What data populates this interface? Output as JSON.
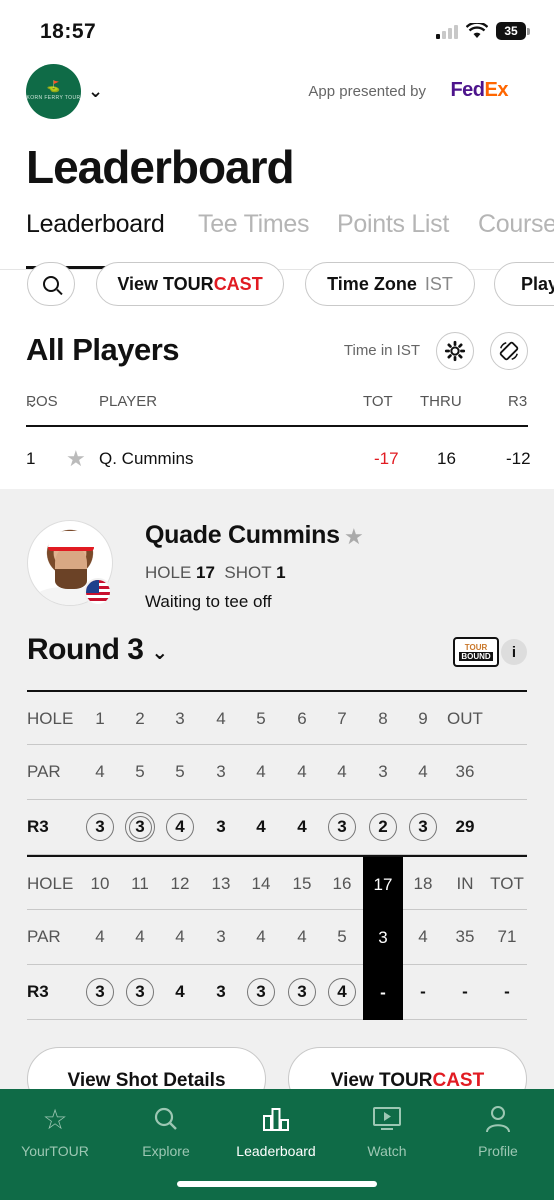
{
  "status": {
    "time": "18:57",
    "battery": "35"
  },
  "brand": {
    "presented_by": "App presented by",
    "sponsor_a": "Fed",
    "sponsor_b": "Ex",
    "logo_text": "KORN FERRY TOUR"
  },
  "page_title": "Leaderboard",
  "tabs": [
    "Leaderboard",
    "Tee Times",
    "Points List",
    "Course"
  ],
  "chips": {
    "tourcast_a": "View TOUR",
    "tourcast_b": "CAST",
    "timezone_label": "Time Zone",
    "timezone_value": "IST",
    "partial": "Play"
  },
  "section": {
    "title": "All Players",
    "time_in": "Time in IST"
  },
  "table_head": {
    "pos": "POS",
    "player": "PLAYER",
    "tot": "TOT",
    "thru": "THRU",
    "r3": "R3"
  },
  "row": {
    "pos": "1",
    "player": "Q. Cummins",
    "tot": "-17",
    "thru": "16",
    "r3": "-12"
  },
  "player": {
    "name": "Quade Cummins",
    "hole_label": "HOLE",
    "hole": "17",
    "shot_label": "SHOT",
    "shot": "1",
    "status": "Waiting to tee off"
  },
  "round": {
    "title": "Round 3",
    "badge_a": "TOUR",
    "badge_b": "BOUND",
    "info": "i"
  },
  "front": {
    "hole_label": "HOLE",
    "holes": [
      "1",
      "2",
      "3",
      "4",
      "5",
      "6",
      "7",
      "8",
      "9"
    ],
    "out": "OUT",
    "par_label": "PAR",
    "par": [
      "4",
      "5",
      "5",
      "3",
      "4",
      "4",
      "4",
      "3",
      "4"
    ],
    "par_out": "36",
    "r_label": "R3",
    "scores": [
      "3",
      "3",
      "4",
      "3",
      "4",
      "4",
      "3",
      "2",
      "3"
    ],
    "score_out": "29",
    "marks": [
      "circle",
      "double",
      "circle",
      "none",
      "none",
      "none",
      "circle",
      "circle",
      "circle"
    ]
  },
  "back": {
    "hole_label": "HOLE",
    "holes": [
      "10",
      "11",
      "12",
      "13",
      "14",
      "15",
      "16",
      "17",
      "18"
    ],
    "in": "IN",
    "tot": "TOT",
    "par_label": "PAR",
    "par": [
      "4",
      "4",
      "4",
      "3",
      "4",
      "4",
      "5",
      "3",
      "4"
    ],
    "par_in": "35",
    "par_tot": "71",
    "r_label": "R3",
    "scores": [
      "3",
      "3",
      "4",
      "3",
      "3",
      "3",
      "4",
      "-",
      "-"
    ],
    "score_in": "-",
    "score_tot": "-",
    "marks": [
      "circle",
      "circle",
      "none",
      "none",
      "circle",
      "circle",
      "circle",
      "none",
      "none"
    ],
    "current_hole_index": 7
  },
  "buttons": {
    "shot_details": "View Shot Details",
    "tourcast_a": "View TOUR",
    "tourcast_b": "CAST"
  },
  "tabbar": [
    {
      "label": "YourTOUR",
      "icon": "star-icon"
    },
    {
      "label": "Explore",
      "icon": "search-icon"
    },
    {
      "label": "Leaderboard",
      "icon": "leaderboard-icon"
    },
    {
      "label": "Watch",
      "icon": "watch-icon"
    },
    {
      "label": "Profile",
      "icon": "profile-icon"
    }
  ]
}
